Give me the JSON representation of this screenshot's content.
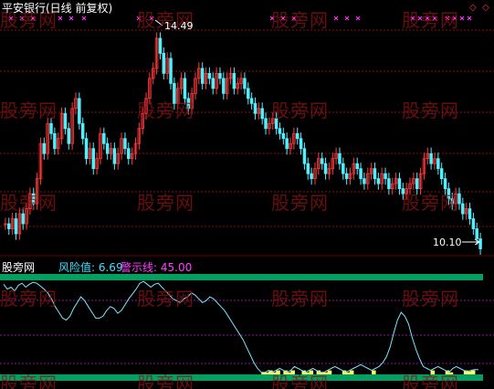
{
  "header": {
    "title": "平安银行(日线 前复权)",
    "sub_name": "股旁网",
    "indicator_label": "风险值: 6.69",
    "warning_label": "警示线: 45.00"
  },
  "icons": {
    "top_right_a": "diamond-outline-icon",
    "top_right_b": "diamond-outline-icon",
    "color_a": "#ff3030",
    "color_b": "#ff3030"
  },
  "watermark": {
    "text": "股旁网"
  },
  "colors": {
    "up": "#ff3b3b",
    "down": "#4ff0ff",
    "grid": "#8a1010",
    "risk_line": "#7fe6ff",
    "band": "#00a060",
    "fill": "#ffff66",
    "marker": "#ff40ff"
  },
  "chart_data": [
    {
      "type": "candlestick",
      "title": "平安银行(日线 前复权)",
      "annotations": [
        {
          "label": "14.49",
          "kind": "high"
        },
        {
          "label": "10.10",
          "kind": "low"
        }
      ],
      "ylim": [
        10.0,
        14.7
      ],
      "close": [
        10.6,
        10.5,
        10.7,
        10.4,
        10.8,
        10.6,
        10.9,
        11.2,
        11.0,
        11.5,
        12.2,
        12.0,
        12.6,
        12.4,
        12.1,
        12.3,
        12.8,
        12.5,
        12.2,
        12.9,
        13.1,
        12.6,
        12.3,
        11.9,
        12.1,
        11.7,
        11.9,
        12.4,
        12.2,
        12.0,
        12.1,
        11.8,
        12.0,
        12.3,
        12.1,
        11.9,
        12.0,
        12.2,
        12.5,
        12.8,
        13.1,
        13.5,
        13.7,
        14.3,
        14.0,
        13.6,
        13.9,
        13.4,
        13.0,
        13.3,
        13.5,
        13.1,
        12.9,
        13.2,
        13.5,
        13.7,
        13.4,
        13.6,
        13.5,
        13.3,
        13.6,
        13.5,
        13.2,
        13.5,
        13.6,
        13.3,
        13.4,
        13.5,
        13.3,
        13.1,
        13.0,
        12.8,
        12.9,
        12.7,
        12.5,
        12.6,
        12.7,
        12.5,
        12.4,
        12.3,
        12.1,
        12.2,
        12.4,
        12.3,
        12.1,
        11.8,
        11.6,
        11.5,
        11.7,
        11.9,
        11.8,
        11.6,
        11.7,
        11.9,
        12.0,
        11.8,
        11.6,
        11.5,
        11.6,
        11.8,
        11.7,
        11.5,
        11.4,
        11.6,
        11.7,
        11.5,
        11.4,
        11.6,
        11.5,
        11.3,
        11.4,
        11.5,
        11.3,
        11.2,
        11.3,
        11.4,
        11.5,
        11.3,
        11.6,
        11.9,
        12.0,
        11.8,
        11.9,
        11.7,
        11.5,
        11.3,
        11.1,
        11.0,
        11.2,
        11.0,
        10.8,
        10.9,
        10.7,
        10.5,
        10.3,
        10.1
      ],
      "markers_top": "magenta x marks along the top edge"
    },
    {
      "type": "line",
      "series": [
        {
          "name": "风险值",
          "color": "#7fe6ff",
          "last": 6.69
        },
        {
          "name": "警示线",
          "color": "#ff40ff",
          "value": 45.0
        }
      ],
      "ylim": [
        0,
        100
      ],
      "risk": [
        95,
        90,
        92,
        88,
        94,
        96,
        92,
        95,
        97,
        96,
        93,
        90,
        86,
        80,
        72,
        66,
        60,
        58,
        62,
        70,
        76,
        82,
        78,
        72,
        66,
        60,
        60,
        62,
        68,
        72,
        70,
        65,
        68,
        74,
        80,
        85,
        90,
        96,
        98,
        95,
        92,
        95,
        96,
        92,
        88,
        84,
        80,
        78,
        76,
        80,
        82,
        86,
        84,
        80,
        76,
        78,
        82,
        80,
        76,
        72,
        68,
        62,
        56,
        50,
        44,
        38,
        30,
        22,
        14,
        8,
        4,
        4,
        6,
        4,
        6,
        8,
        6,
        4,
        6,
        10,
        8,
        6,
        4,
        6,
        8,
        6,
        4,
        4,
        6,
        8,
        10,
        8,
        6,
        4,
        6,
        8,
        10,
        12,
        10,
        8,
        6,
        8,
        10,
        14,
        20,
        30,
        45,
        58,
        66,
        62,
        54,
        40,
        28,
        18,
        10,
        8,
        6,
        8,
        10,
        8,
        6,
        4,
        8,
        10,
        8,
        6,
        5,
        6,
        7,
        6.69
      ]
    }
  ]
}
